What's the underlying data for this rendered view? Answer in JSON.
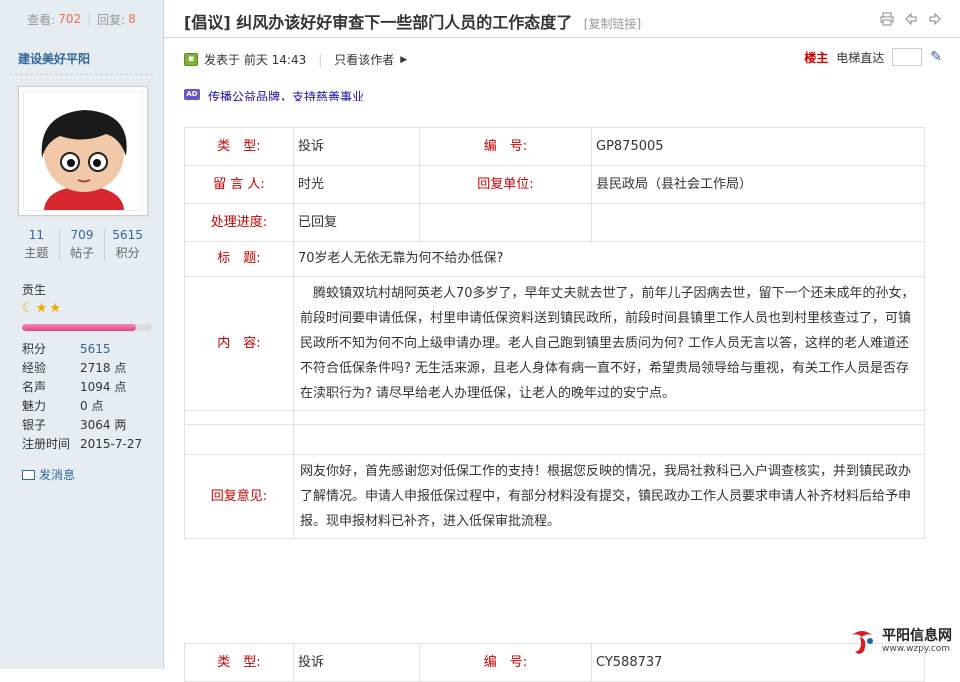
{
  "stats": {
    "views_label": "查看:",
    "views": "702",
    "replies_label": "回复:",
    "replies": "8"
  },
  "thread": {
    "title": "[倡议] 纠风办该好好审查下一些部门人员的工作态度了",
    "copy_link": "[复制链接]"
  },
  "author": {
    "name": "建设美好平阳",
    "counts": [
      {
        "value": "11",
        "label": "主题"
      },
      {
        "value": "709",
        "label": "帖子"
      },
      {
        "value": "5615",
        "label": "积分"
      }
    ],
    "rank": "贡生",
    "progress": 0.88,
    "info": [
      {
        "k": "积分",
        "v": "5615"
      },
      {
        "k": "经验",
        "v": "2718 点"
      },
      {
        "k": "名声",
        "v": "1094 点"
      },
      {
        "k": "魅力",
        "v": "0 点"
      },
      {
        "k": "银子",
        "v": "3064 两"
      },
      {
        "k": "注册时间",
        "v": "2015-7-27"
      }
    ],
    "pm": "发消息"
  },
  "post": {
    "posted": "发表于 前天 14:43",
    "only_author": "只看该作者",
    "floor": "楼主",
    "jump": "电梯直达",
    "ad_tag": "AD",
    "ad_text": "传播公益品牌，支持慈善事业"
  },
  "record1": {
    "type_label": "类　型:",
    "type": "投诉",
    "id_label": "编　号:",
    "id": "GP875005",
    "from_label": "留 言 人:",
    "from": "时光",
    "unit_label": "回复单位:",
    "unit": "县民政局（县社会工作局）",
    "progress_label": "处理进度:",
    "progress": "已回复",
    "title_label": "标　题:",
    "title": "70岁老人无依无靠为何不给办低保?",
    "content_label": "内　容:",
    "content": "　腾蛟镇双坑村胡阿英老人70多岁了，早年丈夫就去世了，前年儿子因病去世，留下一个还未成年的孙女，前段时间要申请低保，村里申请低保资料送到镇民政所，前段时间县镇里工作人员也到村里核查过了，可镇民政所不知为何不向上级申请办理。老人自己跑到镇里去质问为何? 工作人员无言以答，这样的老人难道还不符合低保条件吗? 无生活来源，且老人身体有病一直不好，希望贵局领导给与重视，有关工作人员是否存在渎职行为? 请尽早给老人办理低保，让老人的晚年过的安宁点。",
    "reply_label": "回复意见:",
    "reply": "网友你好，首先感谢您对低保工作的支持！根据您反映的情况，我局社救科已入户调查核实，并到镇民政办了解情况。申请人申报低保过程中，有部分材料没有提交，镇民政办工作人员要求申请人补齐材料后给予申报。现申报材料已补齐，进入低保审批流程。"
  },
  "record2": {
    "type_label": "类　型:",
    "type": "投诉",
    "id_label": "编　号:",
    "id": "CY588737"
  },
  "watermark": {
    "name": "平阳信息网",
    "url": "www.wzpy.com"
  },
  "colors": {
    "sidebar_bg": "#e5edf2",
    "border": "#c2d5e3",
    "label_red": "#cc0000",
    "link_blue": "#336699",
    "count_orange": "#f26c4f"
  }
}
